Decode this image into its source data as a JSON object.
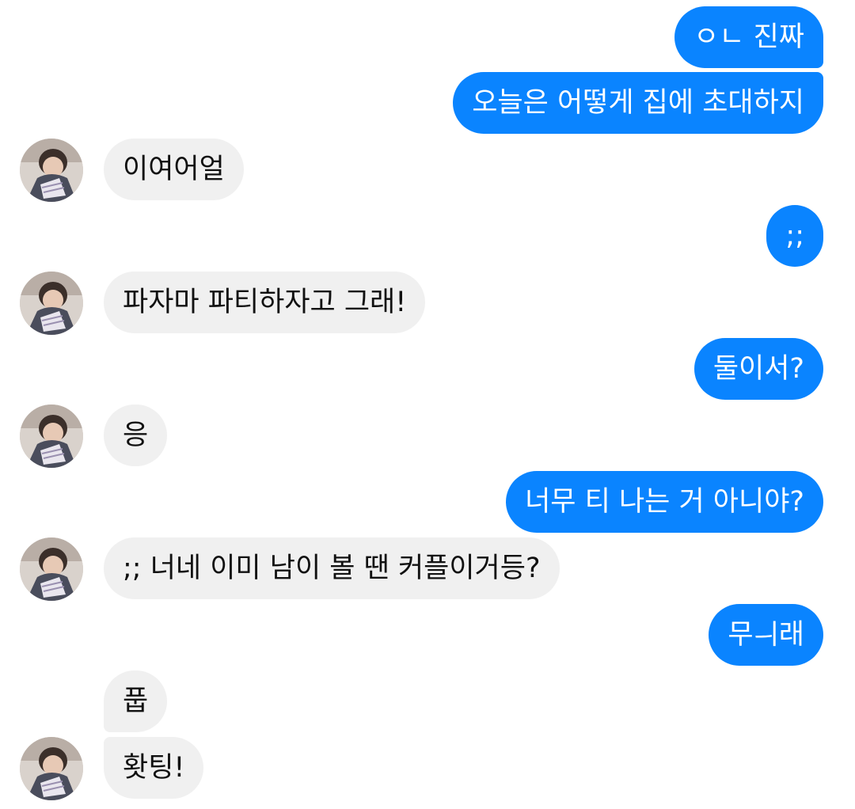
{
  "colors": {
    "sent_bubble": "#0a84ff",
    "received_bubble": "#f0f0f0",
    "sent_text": "#ffffff",
    "received_text": "#111111"
  },
  "messages": [
    {
      "side": "sent",
      "text": "ㅇㄴ 진짜"
    },
    {
      "side": "sent",
      "text": "오늘은 어떻게 집에 초대하지"
    },
    {
      "side": "received",
      "text": "이여어얼"
    },
    {
      "side": "sent",
      "text": ";;"
    },
    {
      "side": "received",
      "text": "파자마 파티하자고 그래!"
    },
    {
      "side": "sent",
      "text": "둘이서?"
    },
    {
      "side": "received",
      "text": "응"
    },
    {
      "side": "sent",
      "text": "너무 티 나는 거 아니야?"
    },
    {
      "side": "received",
      "text": ";; 너네 이미 남이 볼 땐 커플이거등?"
    },
    {
      "side": "sent",
      "text": "무ㅢ래"
    },
    {
      "side": "received",
      "text": "풉"
    },
    {
      "side": "received",
      "text": "홧팅!"
    }
  ]
}
